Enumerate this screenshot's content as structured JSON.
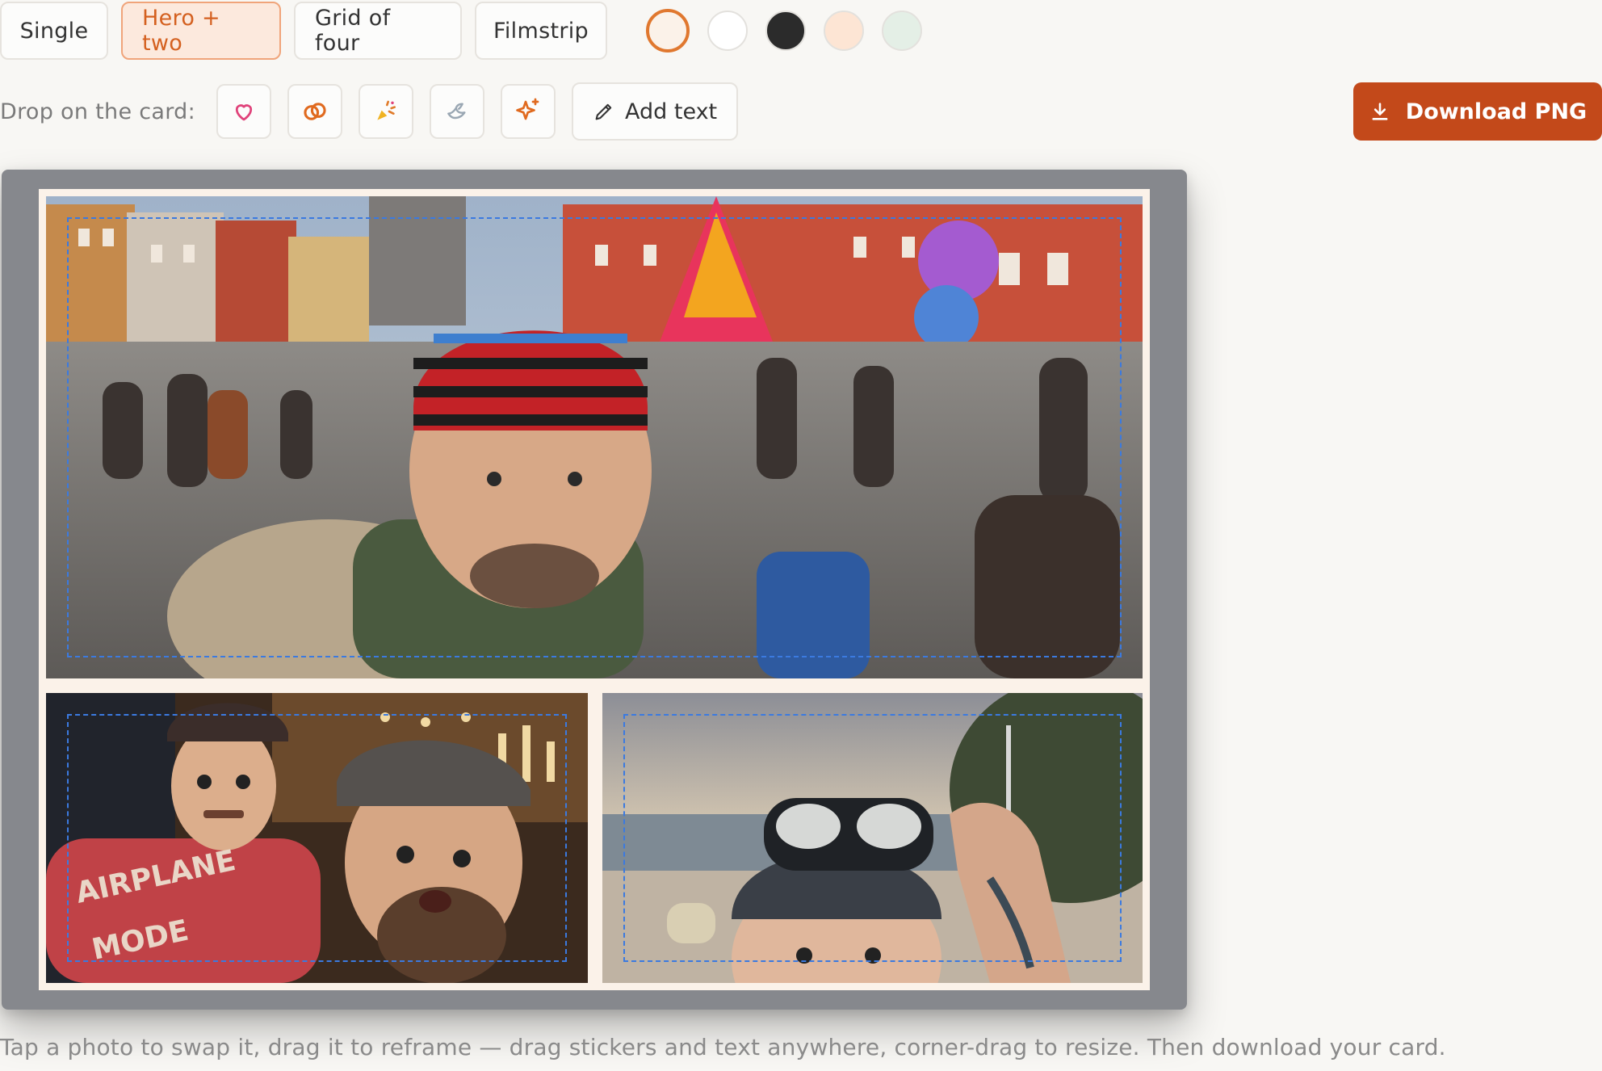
{
  "layouts": [
    {
      "label": "Single",
      "active": false
    },
    {
      "label": "Hero + two",
      "active": true
    },
    {
      "label": "Grid of four",
      "active": false
    },
    {
      "label": "Filmstrip",
      "active": false
    }
  ],
  "swatches": [
    {
      "color": "#fbf2e9",
      "selected": true
    },
    {
      "color": "#ffffff",
      "selected": false
    },
    {
      "color": "#2b2b2b",
      "selected": false
    },
    {
      "color": "#fde5d4",
      "selected": false
    },
    {
      "color": "#e4efe6",
      "selected": false
    }
  ],
  "stickers": {
    "label": "Drop on the card:",
    "items": [
      "heart-icon",
      "rings-icon",
      "confetti-icon",
      "dove-icon",
      "sparkle-icon"
    ],
    "add_text_label": "Add text"
  },
  "download": {
    "label": "Download PNG",
    "color": "#c3491a"
  },
  "card": {
    "background": "#fbf2e9",
    "photo_count": 3
  },
  "hint": "Tap a photo to swap it, drag it to reframe — drag stickers and text anywhere, corner-drag to resize. Then download your card."
}
